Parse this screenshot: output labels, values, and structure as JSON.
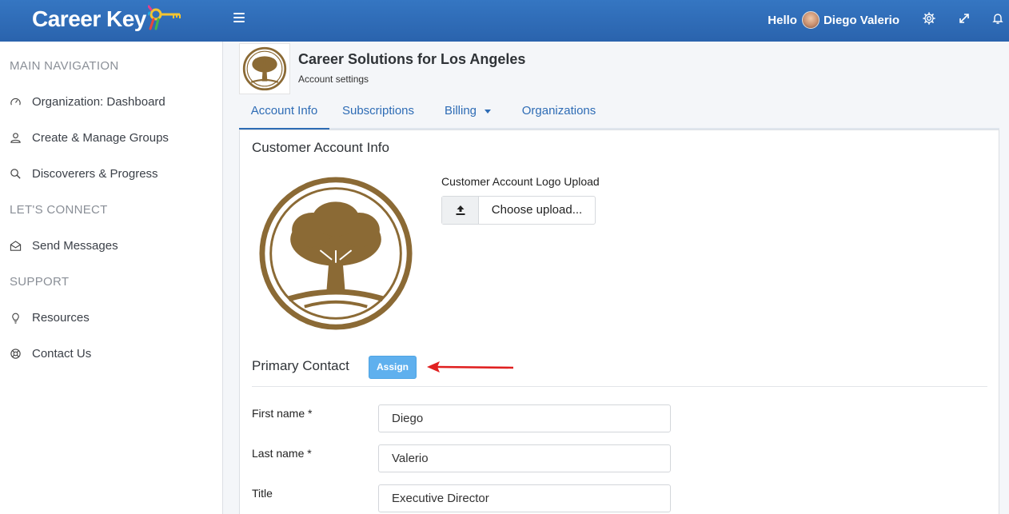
{
  "header": {
    "brand": "Career Key",
    "greeting": "Hello",
    "user_name": "Diego Valerio",
    "icons": [
      "menu-icon",
      "gear-icon",
      "expand-icon",
      "bell-icon"
    ]
  },
  "sidebar": {
    "sections": [
      {
        "title": "MAIN NAVIGATION"
      },
      {
        "title": "LET'S CONNECT"
      },
      {
        "title": "SUPPORT"
      }
    ],
    "items": [
      {
        "label": "Organization: Dashboard",
        "icon": "gauge-icon"
      },
      {
        "label": "Create & Manage Groups",
        "icon": "user-icon"
      },
      {
        "label": "Discoverers & Progress",
        "icon": "search-icon"
      },
      {
        "label": "Send Messages",
        "icon": "envelope-icon"
      },
      {
        "label": "Resources",
        "icon": "lightbulb-icon"
      },
      {
        "label": "Contact Us",
        "icon": "lifebuoy-icon"
      }
    ]
  },
  "org": {
    "name": "Career Solutions for Los Angeles",
    "subtitle": "Account settings"
  },
  "tabs": [
    {
      "label": "Account Info",
      "active": true
    },
    {
      "label": "Subscriptions"
    },
    {
      "label": "Billing"
    },
    {
      "label": "Organizations"
    }
  ],
  "panel": {
    "title": "Customer Account Info",
    "upload_label": "Customer Account Logo Upload",
    "upload_button": "Choose upload...",
    "contact_title": "Primary Contact",
    "assign_label": "Assign",
    "fields": [
      {
        "label": "First name *",
        "value": "Diego"
      },
      {
        "label": "Last name *",
        "value": "Valerio"
      },
      {
        "label": "Title",
        "value": "Executive Director"
      }
    ]
  },
  "colors": {
    "header": "#2a63ad",
    "accent": "#2e6cb5",
    "assign": "#5fb0ee",
    "logo_brown": "#8b6a35",
    "annotation_arrow": "#e02020"
  }
}
